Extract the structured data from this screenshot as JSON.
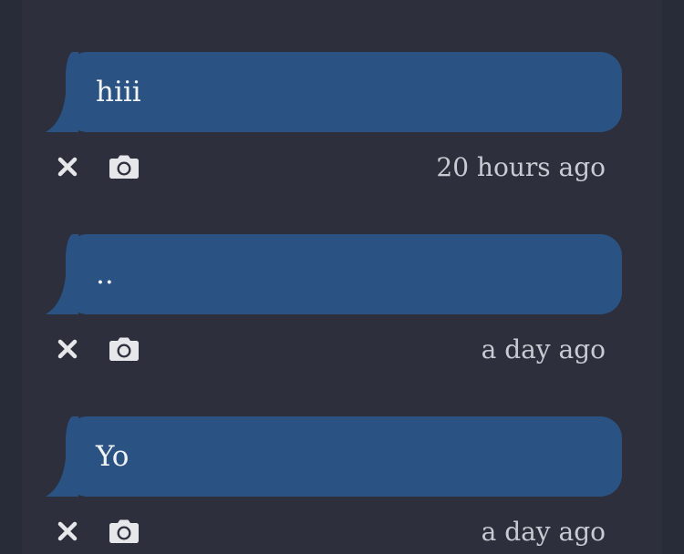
{
  "colors": {
    "background": "#282c38",
    "panel": "#2d303c",
    "bubble": "#2a5384",
    "text": "#f2f3f5",
    "timestamp": "#c9cbd2",
    "icons": "#e6e7ea"
  },
  "messages": [
    {
      "text": "hiii",
      "timestamp": "20 hours ago",
      "actions": {
        "close_icon": "close-icon",
        "camera_icon": "camera-icon"
      }
    },
    {
      "text": "..",
      "timestamp": "a day ago",
      "actions": {
        "close_icon": "close-icon",
        "camera_icon": "camera-icon"
      }
    },
    {
      "text": "Yo",
      "timestamp": "a day ago",
      "actions": {
        "close_icon": "close-icon",
        "camera_icon": "camera-icon"
      }
    }
  ]
}
